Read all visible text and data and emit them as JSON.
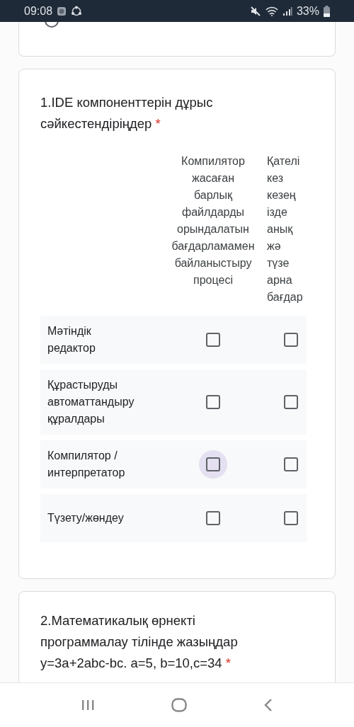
{
  "status_bar": {
    "time": "09:08",
    "battery": "33%"
  },
  "question_1": {
    "number_title": "1.IDE компоненттерін дұрыс сәйкестендіріңдер",
    "required_mark": "*",
    "columns": [
      {
        "lines": [
          "Компилятор",
          "жасаған",
          "барлық",
          "файлдарды",
          "орындалатын",
          "бағдарламамен",
          "байланыстыру",
          "процесі"
        ]
      },
      {
        "lines": [
          "Қателі",
          "кез",
          "кезең",
          "ізде",
          "анық",
          "жә",
          "түзе",
          "арна",
          "бағдар"
        ]
      }
    ],
    "rows": [
      {
        "label": "Мәтіндік редактор",
        "cells": [
          {
            "checked": false,
            "focused": false
          },
          {
            "checked": false,
            "focused": false
          }
        ]
      },
      {
        "label": "Құрастыруды автоматтандыру құралдары",
        "cells": [
          {
            "checked": false,
            "focused": false
          },
          {
            "checked": false,
            "focused": false
          }
        ]
      },
      {
        "label": "Компилятор / интерпретатор",
        "cells": [
          {
            "checked": false,
            "focused": true
          },
          {
            "checked": false,
            "focused": false
          }
        ]
      },
      {
        "label": "Түзету/жөндеу",
        "cells": [
          {
            "checked": false,
            "focused": false
          },
          {
            "checked": false,
            "focused": false
          }
        ]
      }
    ]
  },
  "question_2": {
    "title": "2.Математикалық өрнекті программалау тілінде жазыңдар y=3a+2abc-bc. a=5, b=10,c=34",
    "required_mark": "*"
  }
}
